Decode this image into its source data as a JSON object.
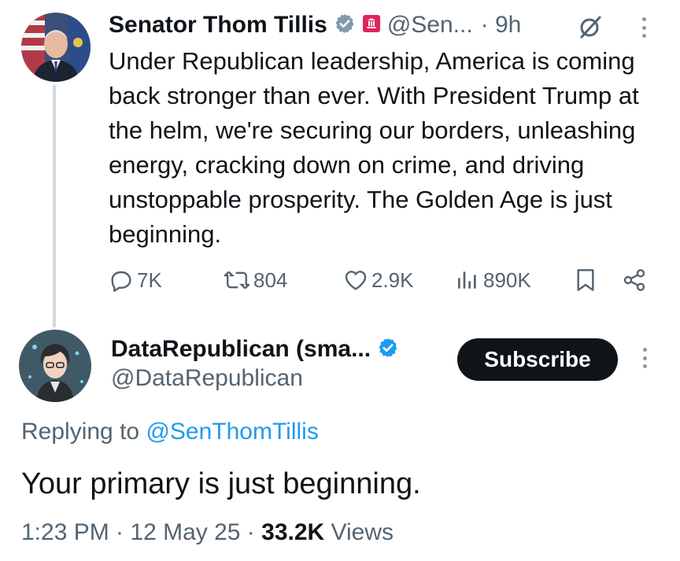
{
  "tweet1": {
    "display_name": "Senator Thom Tillis",
    "handle": "@Sen...",
    "time": "· 9h",
    "text": "Under Republican leadership, America is coming back stronger than ever. With President Trump at the helm, we're securing our borders, unleashing energy, cracking down on crime, and driving unstoppable prosperity. The Golden Age is just beginning.",
    "replies": "7K",
    "reposts": "804",
    "likes": "2.9K",
    "views": "890K"
  },
  "tweet2": {
    "display_name": "DataRepublican (sma...",
    "handle": "@DataRepublican",
    "subscribe_label": "Subscribe",
    "replying_prefix": "Replying to",
    "replying_to": "@SenThomTillis",
    "text": "Your primary is just beginning.",
    "timestamp": "1:23 PM · 12 May 25 ·",
    "views_count": "33.2K",
    "views_label": "Views"
  },
  "colors": {
    "text_primary": "#0f1419",
    "text_secondary": "#536471",
    "accent_blue": "#1d9bf0",
    "gov_badge_gray": "#829aab",
    "gov_label_red": "#e0245e",
    "thread_line": "#cfd9de"
  },
  "icons": [
    "verified-gov-badge-icon",
    "government-label-icon",
    "grok-icon",
    "more-options-icon",
    "reply-icon",
    "repost-icon",
    "like-icon",
    "views-icon",
    "bookmark-icon",
    "share-icon",
    "verified-badge-icon"
  ]
}
